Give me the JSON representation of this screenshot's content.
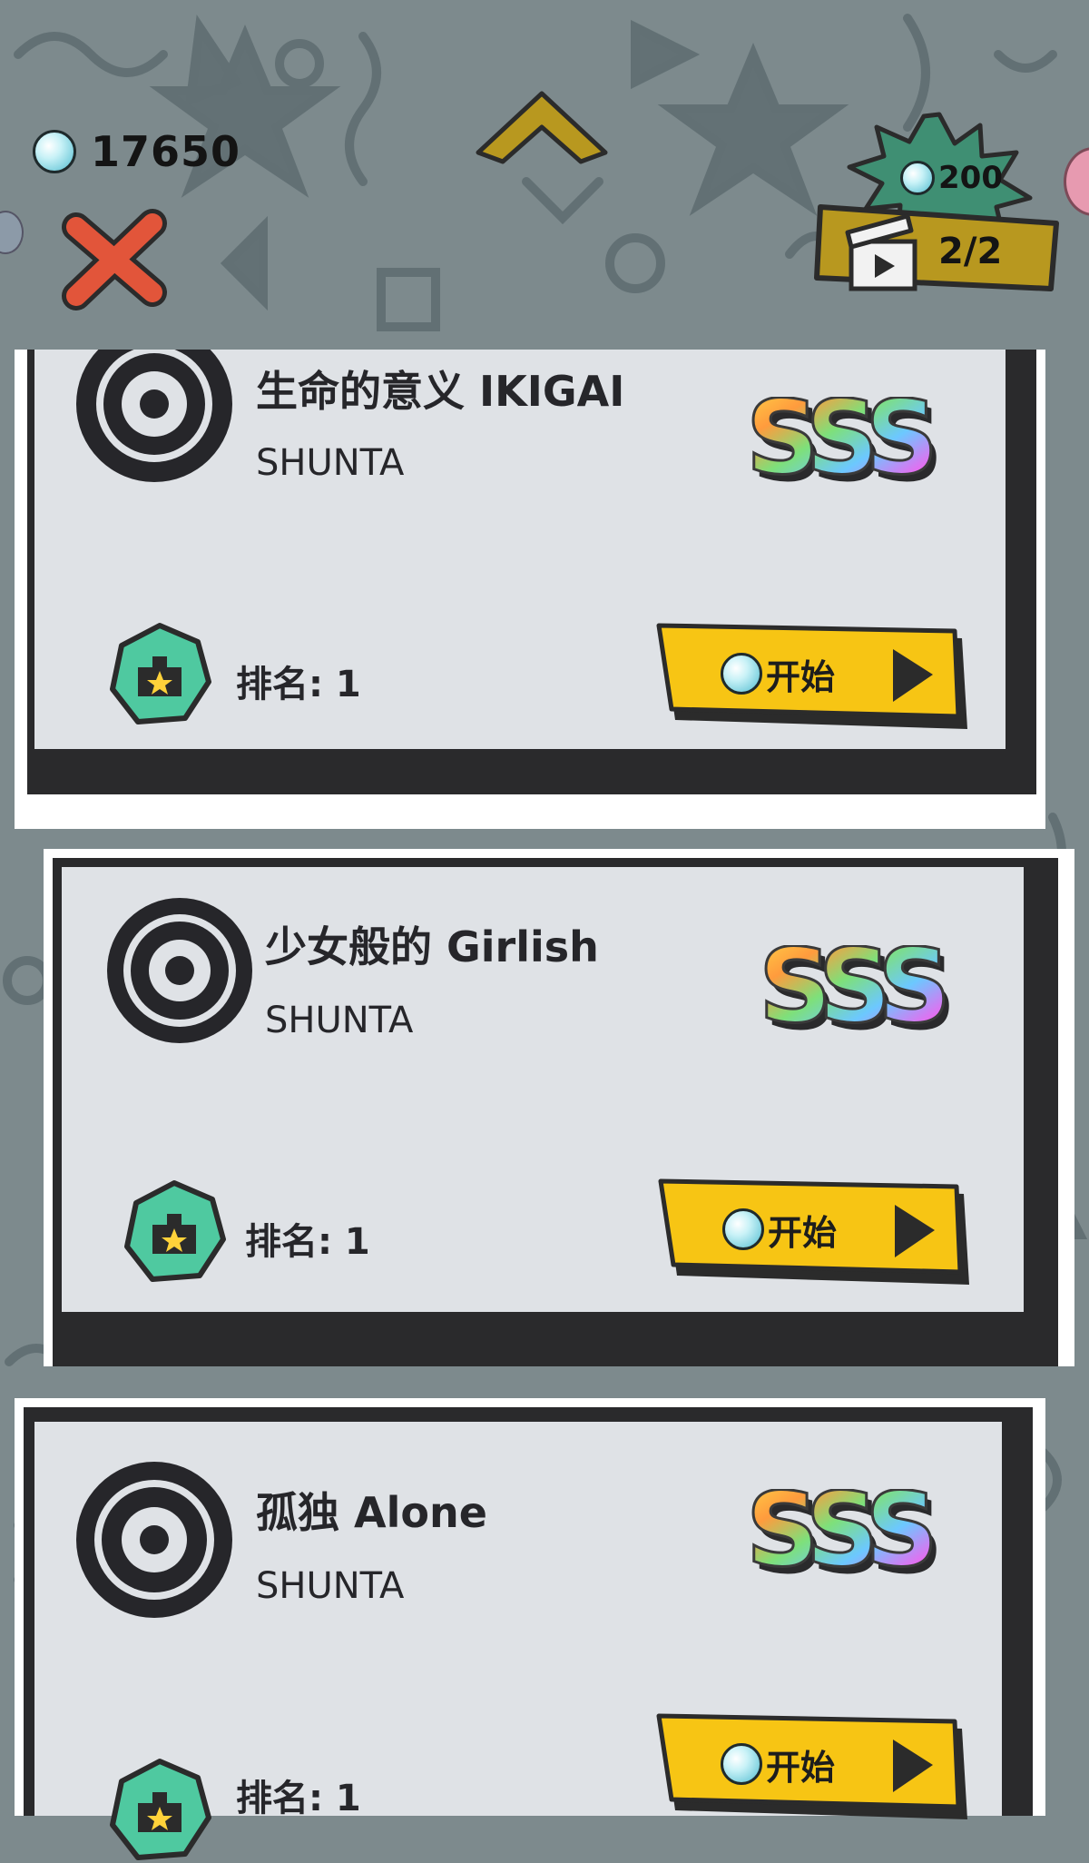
{
  "header": {
    "currency": {
      "icon": "gem-icon",
      "value": "17650"
    },
    "ad_reward": {
      "cost": "200",
      "count": "2/2",
      "icon": "video-clapper-icon"
    },
    "close_icon": "close-icon",
    "up_icon": "chevron-up-icon"
  },
  "songs": [
    {
      "title": "生命的意义 IKIGAI",
      "artist": "SHUNTA",
      "grade": "SSS",
      "rank_label": "排名: 1",
      "start_label": "开始"
    },
    {
      "title": "少女般的 Girlish",
      "artist": "SHUNTA",
      "grade": "SSS",
      "rank_label": "排名: 1",
      "start_label": "开始"
    },
    {
      "title": "孤独 Alone",
      "artist": "SHUNTA",
      "grade": "SSS",
      "rank_label": "排名: 1",
      "start_label": "开始"
    }
  ],
  "colors": {
    "background": "#7d8a8d",
    "panel": "#dfe2e6",
    "panel_dark": "#2a2a2c",
    "start_button": "#f7c514",
    "close_red": "#e2553a",
    "badge_green": "#3f8f73",
    "gold": "#b8981f"
  }
}
